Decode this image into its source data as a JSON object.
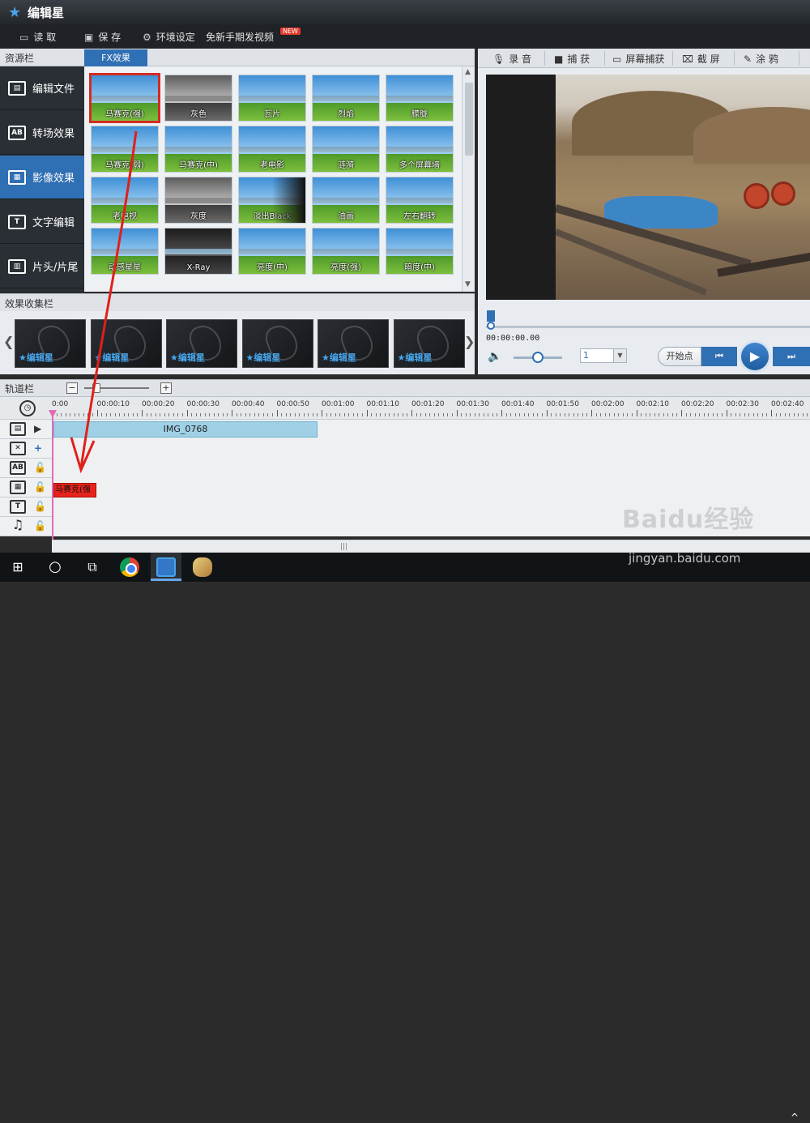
{
  "app": {
    "title": "编辑星"
  },
  "menu": {
    "open": "读 取",
    "save": "保 存",
    "settings": "环境设定",
    "promo": "免新手期发视频",
    "promo_badge": "NEW"
  },
  "left": {
    "resource_header": "资源栏",
    "sidebar": [
      {
        "label": "编辑文件",
        "icon": "film-icon"
      },
      {
        "label": "转场效果",
        "icon": "ab-transition-icon",
        "icon_text": "AB"
      },
      {
        "label": "影像效果",
        "icon": "image-effect-icon",
        "active": true
      },
      {
        "label": "文字编辑",
        "icon": "text-icon",
        "icon_text": "T"
      },
      {
        "label": "片头/片尾",
        "icon": "titles-icon"
      }
    ],
    "fx_tab": "FX效果",
    "effects": [
      "马赛克(强)",
      "灰色",
      "瓦片",
      "烈焰",
      "朦胧",
      "马赛克(弱)",
      "马赛克(中)",
      "老电影",
      "涟漪",
      "多个屏幕墙",
      "老电视",
      "灰度",
      "淡出Black",
      "油画",
      "左右翻转",
      "动感星星",
      "X-Ray",
      "亮度(中)",
      "亮度(强)",
      "暗度(中)"
    ],
    "selected_effect": "马赛克(强)"
  },
  "collection": {
    "header": "效果收集栏",
    "items": [
      "编辑星",
      "编辑星",
      "编辑星",
      "编辑星",
      "编辑星",
      "编辑星"
    ]
  },
  "right": {
    "toolbar": [
      {
        "label": "录 音",
        "icon": "microphone-icon"
      },
      {
        "label": "捕 获",
        "icon": "camera-icon"
      },
      {
        "label": "屏幕捕获",
        "icon": "screen-capture-icon"
      },
      {
        "label": "截 屏",
        "icon": "screenshot-icon"
      },
      {
        "label": "涂 鸦",
        "icon": "brush-icon"
      }
    ],
    "timecode": "00:00:00.00",
    "speed_value": "1",
    "start_point": "开始点",
    "progress": 0
  },
  "timeline": {
    "header": "轨道栏",
    "ticks": [
      "0:00",
      "00:00:10",
      "00:00:20",
      "00:00:30",
      "00:00:40",
      "00:00:50",
      "00:01:00",
      "00:01:10",
      "00:01:20",
      "00:01:30",
      "00:01:40",
      "00:01:50",
      "00:02:00",
      "00:02:10",
      "00:02:20",
      "00:02:30",
      "00:02:40"
    ],
    "video_clip": "IMG_0768",
    "fx_clip": "马赛克(强"
  },
  "watermark": {
    "logo": "Baidu经验",
    "url": "jingyan.baidu.com"
  },
  "colors": {
    "accent": "#2f6fb3",
    "selection": "#d42b24",
    "clip_video": "#9fd0e6",
    "clip_fx": "#e8231c",
    "playhead": "#e46bb3"
  }
}
